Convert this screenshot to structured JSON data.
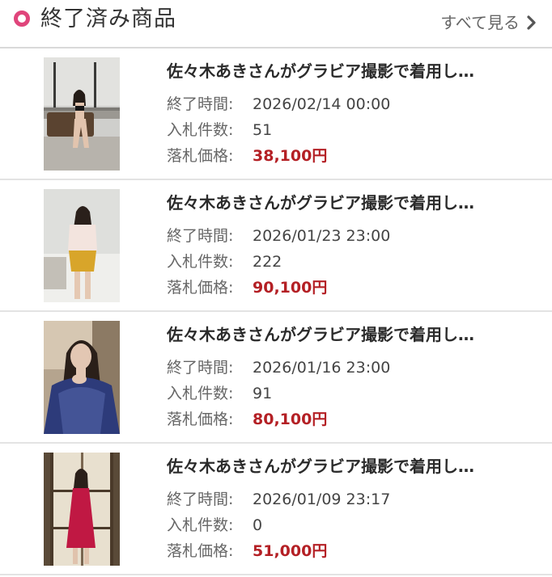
{
  "header": {
    "title": "終了済み商品",
    "see_all_label": "すべて見る"
  },
  "labels": {
    "end_time": "終了時間:",
    "bid_count": "入札件数:",
    "winning_price": "落札価格:"
  },
  "items": [
    {
      "title": "佐々木あきさんがグラビア撮影で着用し…",
      "end_time": "2026/02/14 00:00",
      "bid_count": "51",
      "price": "38,100円"
    },
    {
      "title": "佐々木あきさんがグラビア撮影で着用し…",
      "end_time": "2026/01/23 23:00",
      "bid_count": "222",
      "price": "90,100円"
    },
    {
      "title": "佐々木あきさんがグラビア撮影で着用し…",
      "end_time": "2026/01/16 23:00",
      "bid_count": "91",
      "price": "80,100円"
    },
    {
      "title": "佐々木あきさんがグラビア撮影で着用し…",
      "end_time": "2026/01/09 23:17",
      "bid_count": "0",
      "price": "51,000円"
    }
  ],
  "colors": {
    "accent": "#e0457b",
    "price": "#b42025",
    "divider": "#e3e3e3"
  }
}
